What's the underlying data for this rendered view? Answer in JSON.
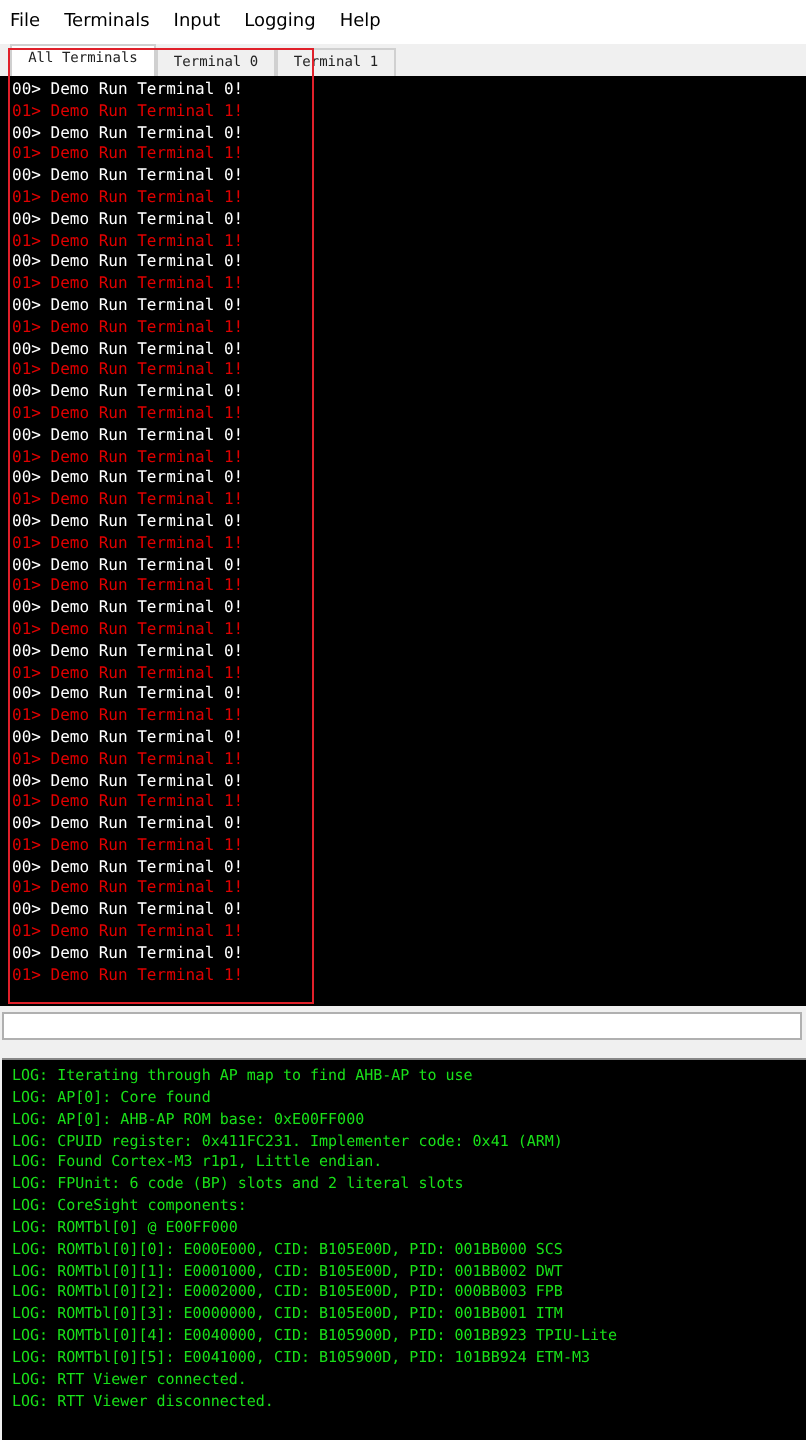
{
  "menu": [
    "File",
    "Terminals",
    "Input",
    "Logging",
    "Help"
  ],
  "tabs": [
    {
      "label": "All Terminals",
      "selected": true
    },
    {
      "label": "Terminal 0",
      "selected": false
    },
    {
      "label": "Terminal 1",
      "selected": false
    }
  ],
  "terminal": {
    "lines": [
      {
        "text": "00> Demo Run Terminal 0!",
        "kind": "t0"
      },
      {
        "text": "01> Demo Run Terminal 1!",
        "kind": "t1"
      },
      {
        "text": "00> Demo Run Terminal 0!",
        "kind": "t0"
      },
      {
        "text": "01> Demo Run Terminal 1!",
        "kind": "t1"
      },
      {
        "text": "00> Demo Run Terminal 0!",
        "kind": "t0"
      },
      {
        "text": "01> Demo Run Terminal 1!",
        "kind": "t1"
      },
      {
        "text": "00> Demo Run Terminal 0!",
        "kind": "t0"
      },
      {
        "text": "01> Demo Run Terminal 1!",
        "kind": "t1"
      },
      {
        "text": "00> Demo Run Terminal 0!",
        "kind": "t0"
      },
      {
        "text": "01> Demo Run Terminal 1!",
        "kind": "t1"
      },
      {
        "text": "00> Demo Run Terminal 0!",
        "kind": "t0"
      },
      {
        "text": "01> Demo Run Terminal 1!",
        "kind": "t1"
      },
      {
        "text": "00> Demo Run Terminal 0!",
        "kind": "t0"
      },
      {
        "text": "01> Demo Run Terminal 1!",
        "kind": "t1"
      },
      {
        "text": "00> Demo Run Terminal 0!",
        "kind": "t0"
      },
      {
        "text": "01> Demo Run Terminal 1!",
        "kind": "t1"
      },
      {
        "text": "00> Demo Run Terminal 0!",
        "kind": "t0"
      },
      {
        "text": "01> Demo Run Terminal 1!",
        "kind": "t1"
      },
      {
        "text": "00> Demo Run Terminal 0!",
        "kind": "t0"
      },
      {
        "text": "01> Demo Run Terminal 1!",
        "kind": "t1"
      },
      {
        "text": "00> Demo Run Terminal 0!",
        "kind": "t0"
      },
      {
        "text": "01> Demo Run Terminal 1!",
        "kind": "t1"
      },
      {
        "text": "00> Demo Run Terminal 0!",
        "kind": "t0"
      },
      {
        "text": "01> Demo Run Terminal 1!",
        "kind": "t1"
      },
      {
        "text": "00> Demo Run Terminal 0!",
        "kind": "t0"
      },
      {
        "text": "01> Demo Run Terminal 1!",
        "kind": "t1"
      },
      {
        "text": "00> Demo Run Terminal 0!",
        "kind": "t0"
      },
      {
        "text": "01> Demo Run Terminal 1!",
        "kind": "t1"
      },
      {
        "text": "00> Demo Run Terminal 0!",
        "kind": "t0"
      },
      {
        "text": "01> Demo Run Terminal 1!",
        "kind": "t1"
      },
      {
        "text": "00> Demo Run Terminal 0!",
        "kind": "t0"
      },
      {
        "text": "01> Demo Run Terminal 1!",
        "kind": "t1"
      },
      {
        "text": "00> Demo Run Terminal 0!",
        "kind": "t0"
      },
      {
        "text": "01> Demo Run Terminal 1!",
        "kind": "t1"
      },
      {
        "text": "00> Demo Run Terminal 0!",
        "kind": "t0"
      },
      {
        "text": "01> Demo Run Terminal 1!",
        "kind": "t1"
      },
      {
        "text": "00> Demo Run Terminal 0!",
        "kind": "t0"
      },
      {
        "text": "01> Demo Run Terminal 1!",
        "kind": "t1"
      },
      {
        "text": "00> Demo Run Terminal 0!",
        "kind": "t0"
      },
      {
        "text": "01> Demo Run Terminal 1!",
        "kind": "t1"
      },
      {
        "text": "00> Demo Run Terminal 0!",
        "kind": "t0"
      },
      {
        "text": "01> Demo Run Terminal 1!",
        "kind": "t1"
      }
    ]
  },
  "log": {
    "lines": [
      "LOG: Iterating through AP map to find AHB-AP to use",
      "LOG: AP[0]: Core found",
      "LOG: AP[0]: AHB-AP ROM base: 0xE00FF000",
      "LOG: CPUID register: 0x411FC231. Implementer code: 0x41 (ARM)",
      "LOG: Found Cortex-M3 r1p1, Little endian.",
      "LOG: FPUnit: 6 code (BP) slots and 2 literal slots",
      "LOG: CoreSight components:",
      "LOG: ROMTbl[0] @ E00FF000",
      "LOG: ROMTbl[0][0]: E000E000, CID: B105E00D, PID: 001BB000 SCS",
      "LOG: ROMTbl[0][1]: E0001000, CID: B105E00D, PID: 001BB002 DWT",
      "LOG: ROMTbl[0][2]: E0002000, CID: B105E00D, PID: 000BB003 FPB",
      "LOG: ROMTbl[0][3]: E0000000, CID: B105E00D, PID: 001BB001 ITM",
      "LOG: ROMTbl[0][4]: E0040000, CID: B105900D, PID: 001BB923 TPIU-Lite",
      "LOG: ROMTbl[0][5]: E0041000, CID: B105900D, PID: 101BB924 ETM-M3",
      "LOG: RTT Viewer connected.",
      "LOG: RTT Viewer disconnected."
    ]
  }
}
